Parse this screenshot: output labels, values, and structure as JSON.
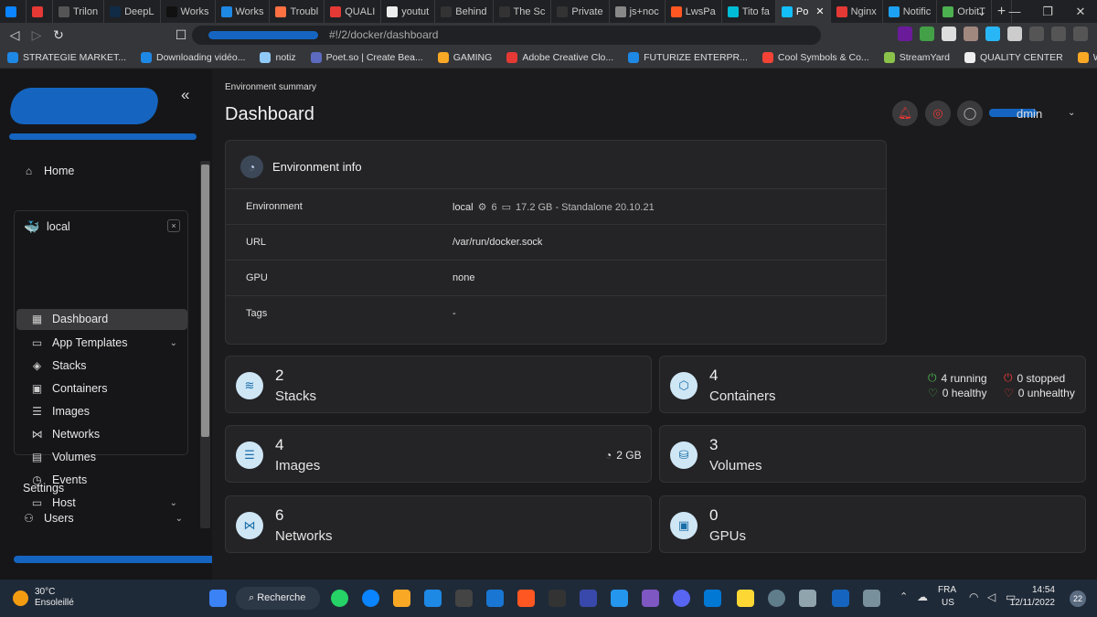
{
  "browser": {
    "tabs": [
      {
        "label": "",
        "color": "#0a84ff"
      },
      {
        "label": "",
        "color": "#e53935"
      },
      {
        "label": "Trilon",
        "color": "#555"
      },
      {
        "label": "DeepL",
        "color": "#0f2b46"
      },
      {
        "label": "Works",
        "color": "#111"
      },
      {
        "label": "Works",
        "color": "#1e88e5"
      },
      {
        "label": "Troubl",
        "color": "#ff7043"
      },
      {
        "label": "QUALI",
        "color": "#e53935"
      },
      {
        "label": "youtut",
        "color": "#eee"
      },
      {
        "label": "Behind",
        "color": "#333"
      },
      {
        "label": "The Sc",
        "color": "#333"
      },
      {
        "label": "Private",
        "color": "#333"
      },
      {
        "label": "js+noc",
        "color": "#888"
      },
      {
        "label": "LwsPa",
        "color": "#ff5722"
      },
      {
        "label": "Tito fa",
        "color": "#00bcd4"
      },
      {
        "label": "Po",
        "color": "#13bef9",
        "active": true
      },
      {
        "label": "Nginx",
        "color": "#e53935"
      },
      {
        "label": "Notific",
        "color": "#1da1f2"
      },
      {
        "label": "OrbitT",
        "color": "#4caf50"
      }
    ],
    "new_tab": "+",
    "url_text": "#!/2/docker/dashboard",
    "bookmarks": [
      {
        "label": "STRATEGIE MARKET...",
        "color": "#1e88e5"
      },
      {
        "label": "Downloading vidéo...",
        "color": "#1e88e5"
      },
      {
        "label": "notiz",
        "color": "#90caf9"
      },
      {
        "label": "Poet.so | Create Bea...",
        "color": "#5c6bc0"
      },
      {
        "label": "GAMING",
        "color": "#f9a825"
      },
      {
        "label": "Adobe Creative Clo...",
        "color": "#e53935"
      },
      {
        "label": "FUTURIZE ENTERPR...",
        "color": "#1e88e5"
      },
      {
        "label": "Cool Symbols & Co...",
        "color": "#f44336"
      },
      {
        "label": "StreamYard",
        "color": "#8bc34a"
      },
      {
        "label": "QUALITY CENTER",
        "color": "#eee"
      },
      {
        "label": "WORK",
        "color": "#f9a825"
      }
    ]
  },
  "sidebar": {
    "collapse_glyph": "«",
    "home_label": "Home",
    "environment_name": "local",
    "close_glyph": "×",
    "items": [
      {
        "label": "Dashboard",
        "icon": "▦",
        "active": true
      },
      {
        "label": "App Templates",
        "icon": "▭",
        "chevron": true
      },
      {
        "label": "Stacks",
        "icon": "◈"
      },
      {
        "label": "Containers",
        "icon": "▣"
      },
      {
        "label": "Images",
        "icon": "☰"
      },
      {
        "label": "Networks",
        "icon": "⋈"
      },
      {
        "label": "Volumes",
        "icon": "▤"
      },
      {
        "label": "Events",
        "icon": "◷"
      },
      {
        "label": "Host",
        "icon": "▭",
        "chevron": true
      }
    ],
    "settings_label": "Settings",
    "users_label": "Users"
  },
  "header": {
    "breadcrumb": "Environment summary",
    "title": "Dashboard",
    "user_suffix": "dmin"
  },
  "env_info": {
    "title": "Environment info",
    "rows": [
      {
        "key": "Environment",
        "value": "local",
        "cpu": "6",
        "memory": "17.2 GB - Standalone 20.10.21"
      },
      {
        "key": "URL",
        "value": "/var/run/docker.sock"
      },
      {
        "key": "GPU",
        "value": "none"
      },
      {
        "key": "Tags",
        "value": "-"
      }
    ]
  },
  "stats": {
    "stacks": {
      "count": "2",
      "label": "Stacks"
    },
    "containers": {
      "count": "4",
      "label": "Containers",
      "running": "4 running",
      "stopped": "0 stopped",
      "healthy": "0 healthy",
      "unhealthy": "0 unhealthy"
    },
    "images": {
      "count": "4",
      "label": "Images",
      "size": "2 GB"
    },
    "volumes": {
      "count": "3",
      "label": "Volumes"
    },
    "networks": {
      "count": "6",
      "label": "Networks"
    },
    "gpus": {
      "count": "0",
      "label": "GPUs"
    }
  },
  "taskbar": {
    "temperature": "30°C",
    "weather": "Ensoleillé",
    "search": "Recherche",
    "lang": "FRA",
    "region": "US",
    "time": "14:54",
    "date": "12/11/2022",
    "notif_count": "22"
  }
}
